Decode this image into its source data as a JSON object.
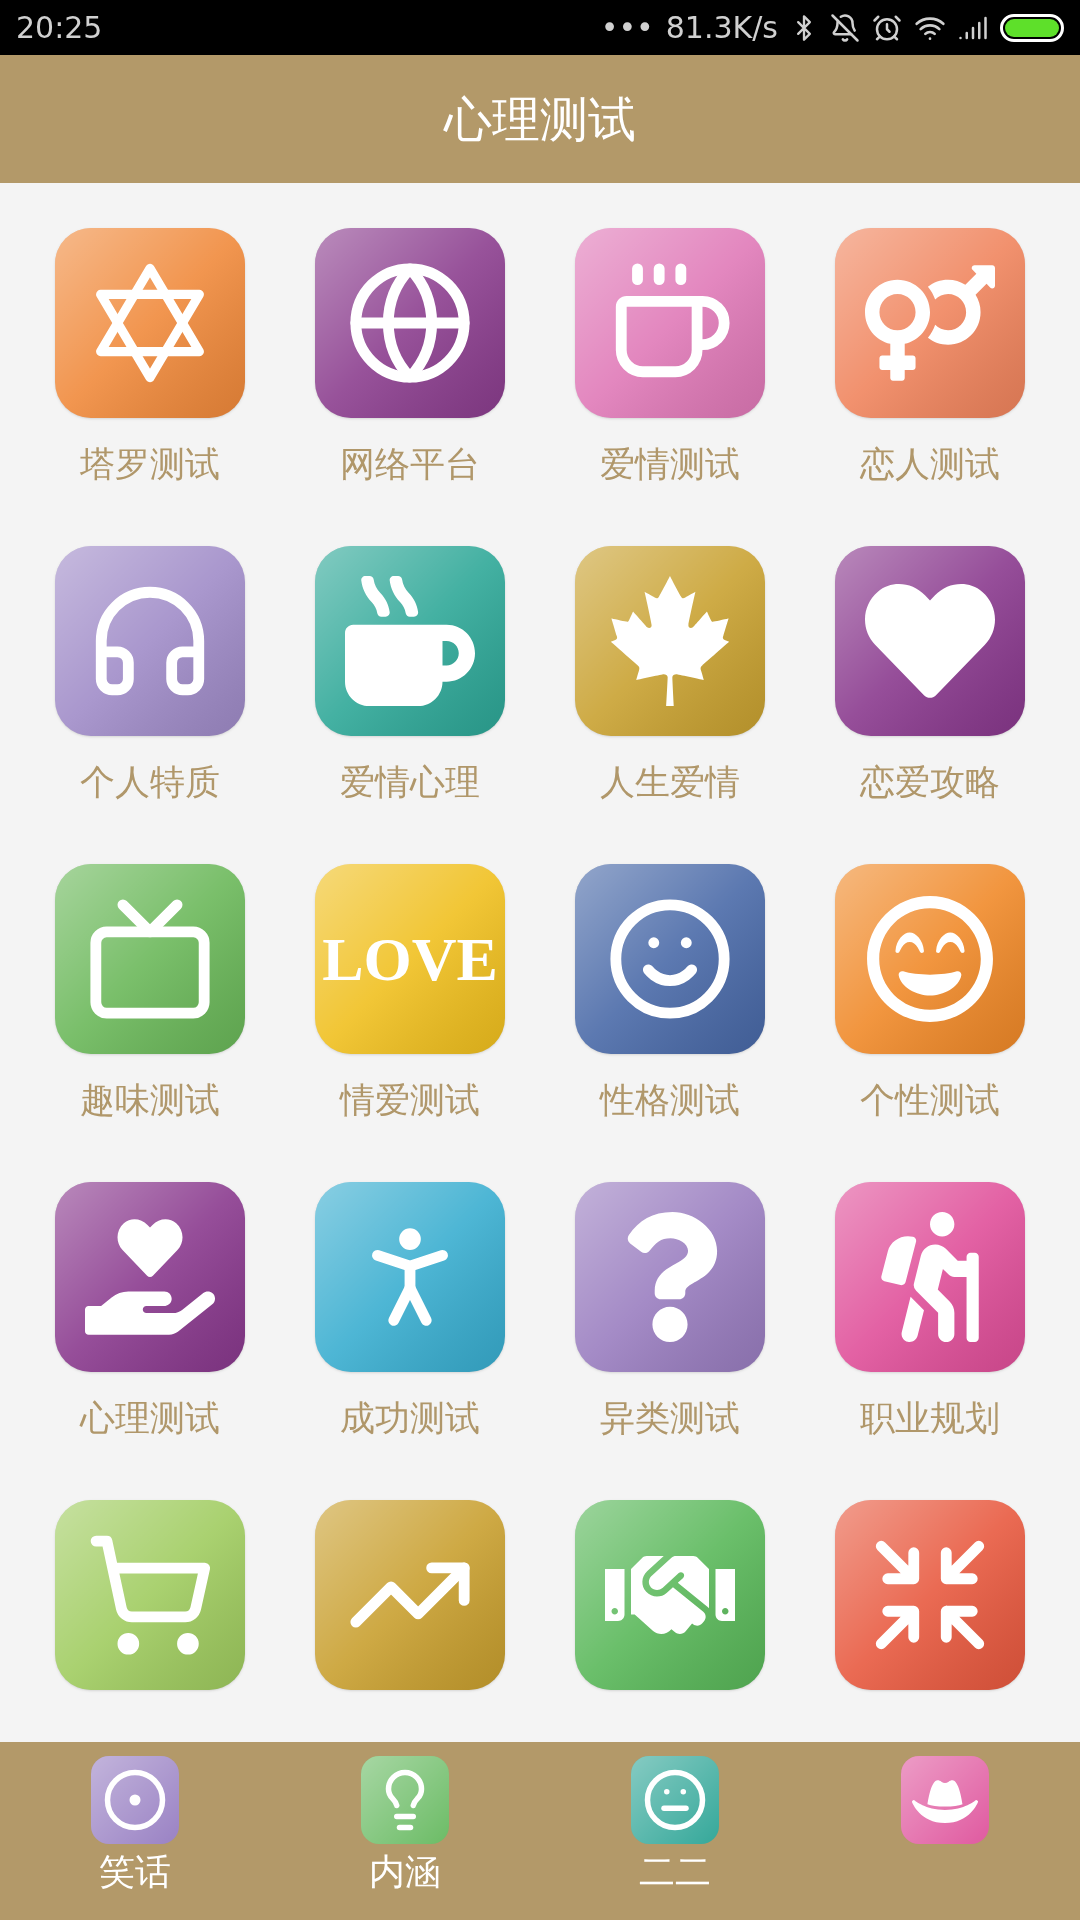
{
  "status_bar": {
    "time": "20:25",
    "dots": "•••",
    "speed": "81.3K/s"
  },
  "header": {
    "title": "心理测试"
  },
  "tile_rows": [
    {
      "tiles": [
        {
          "label": "塔罗测试",
          "color": "#f08a3c"
        },
        {
          "label": "网络平台",
          "color": "#8c3f8f"
        },
        {
          "label": "爱情测试",
          "color": "#e07ab8"
        },
        {
          "label": "恋人测试",
          "color": "#f0855e"
        }
      ]
    },
    {
      "tiles": [
        {
          "label": "个人特质",
          "color": "#a08cc8"
        },
        {
          "label": "爱情心理",
          "color": "#2fa898"
        },
        {
          "label": "人生爱情",
          "color": "#c9a232"
        },
        {
          "label": "恋爱攻略",
          "color": "#8a3a8e"
        }
      ]
    },
    {
      "tiles": [
        {
          "label": "趣味测试",
          "color": "#6bb85a"
        },
        {
          "label": "情爱测试",
          "color": "#f0c020",
          "tile_text": "LOVE"
        },
        {
          "label": "性格测试",
          "color": "#4a6aa8"
        },
        {
          "label": "个性测试",
          "color": "#f08a2a"
        }
      ]
    },
    {
      "tiles": [
        {
          "label": "心理测试",
          "color": "#8a3a8e"
        },
        {
          "label": "成功测试",
          "color": "#3aaed0"
        },
        {
          "label": "异类测试",
          "color": "#9a7ec0"
        },
        {
          "label": "职业规划",
          "color": "#e0509a"
        }
      ]
    },
    {
      "tiles": [
        {
          "color": "#a0cc60"
        },
        {
          "color": "#c9a030"
        },
        {
          "color": "#5ab85a"
        },
        {
          "color": "#e85a40"
        }
      ]
    }
  ],
  "bottom_nav": [
    {
      "label": "笑话",
      "color": "#9a82c4"
    },
    {
      "label": "内涵",
      "color": "#6cbc66"
    },
    {
      "label": "二二",
      "color": "#35a89a"
    },
    {
      "color": "#e05aa0"
    }
  ]
}
